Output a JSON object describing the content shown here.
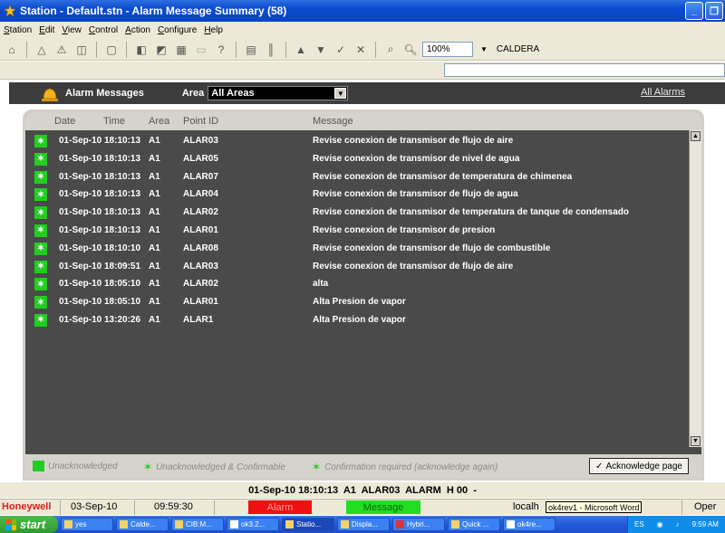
{
  "window": {
    "title": "Station - Default.stn - Alarm Message Summary (58)"
  },
  "menu": [
    "Station",
    "Edit",
    "View",
    "Control",
    "Action",
    "Configure",
    "Help"
  ],
  "toolbar": {
    "zoom": "100%",
    "station_name": "CALDERA"
  },
  "alarm_view": {
    "header_title": "Alarm Messages",
    "area_label": "Area",
    "area_value": "All Areas",
    "all_alarms_link": "All Alarms",
    "columns": [
      "Date",
      "Time",
      "Area",
      "Point ID",
      "Message"
    ],
    "rows": [
      {
        "date": "01-Sep-10",
        "time": "18:10:13",
        "area": "A1",
        "point": "ALAR03",
        "message": "Revise conexion de transmisor de flujo de aire"
      },
      {
        "date": "01-Sep-10",
        "time": "18:10:13",
        "area": "A1",
        "point": "ALAR05",
        "message": "Revise conexion de transmisor de nivel de agua"
      },
      {
        "date": "01-Sep-10",
        "time": "18:10:13",
        "area": "A1",
        "point": "ALAR07",
        "message": "Revise conexion de transmisor de temperatura de chimenea"
      },
      {
        "date": "01-Sep-10",
        "time": "18:10:13",
        "area": "A1",
        "point": "ALAR04",
        "message": "Revise conexion de transmisor de flujo de agua"
      },
      {
        "date": "01-Sep-10",
        "time": "18:10:13",
        "area": "A1",
        "point": "ALAR02",
        "message": "Revise conexion de transmisor de temperatura de tanque de condensado"
      },
      {
        "date": "01-Sep-10",
        "time": "18:10:13",
        "area": "A1",
        "point": "ALAR01",
        "message": "Revise conexion de transmisor de presion"
      },
      {
        "date": "01-Sep-10",
        "time": "18:10:10",
        "area": "A1",
        "point": "ALAR08",
        "message": "Revise conexion de transmisor de flujo de combustible"
      },
      {
        "date": "01-Sep-10",
        "time": "18:09:51",
        "area": "A1",
        "point": "ALAR03",
        "message": "Revise conexion de transmisor de flujo de aire"
      },
      {
        "date": "01-Sep-10",
        "time": "18:05:10",
        "area": "A1",
        "point": "ALAR02",
        "message": "alta"
      },
      {
        "date": "01-Sep-10",
        "time": "18:05:10",
        "area": "A1",
        "point": "ALAR01",
        "message": "Alta Presion de vapor"
      },
      {
        "date": "01-Sep-10",
        "time": "13:20:26",
        "area": "A1",
        "point": "ALAR1",
        "message": "Alta Presion de vapor"
      }
    ],
    "legend": {
      "unacknowledged": "Unacknowledged",
      "unack_confirmable": "Unacknowledged & Confirmable",
      "confirmation_required": "Confirmation required (acknowledge again)"
    },
    "acknowledge_button": "Acknowledge page",
    "star_glyph": "✶"
  },
  "message_line": "01-Sep-10 18:10:13  A1  ALAR03  ALARM  H 00  -",
  "status_bar": {
    "brand": "Honeywell",
    "date": "03-Sep-10",
    "time": "09:59:30",
    "alarm": "Alarm",
    "message": "Message",
    "host": "localh",
    "tooltip": "ok4rev1 - Microsoft Word",
    "mode": "Oper"
  },
  "taskbar": {
    "start": "start",
    "tasks": [
      "yes",
      "Calde...",
      "CIB:M...",
      "ok3.2...",
      "Statio...",
      "Displa...",
      "Hybri...",
      "Quick ...",
      "ok4re..."
    ],
    "lang": "ES",
    "clock": "9:59 AM"
  },
  "colors": {
    "alarm_red": "#ee1111",
    "message_green": "#22dd22",
    "ack_star_green": "#22cc22",
    "panel_bg": "#4a4a4a",
    "title_blue": "#0a4bd0"
  }
}
